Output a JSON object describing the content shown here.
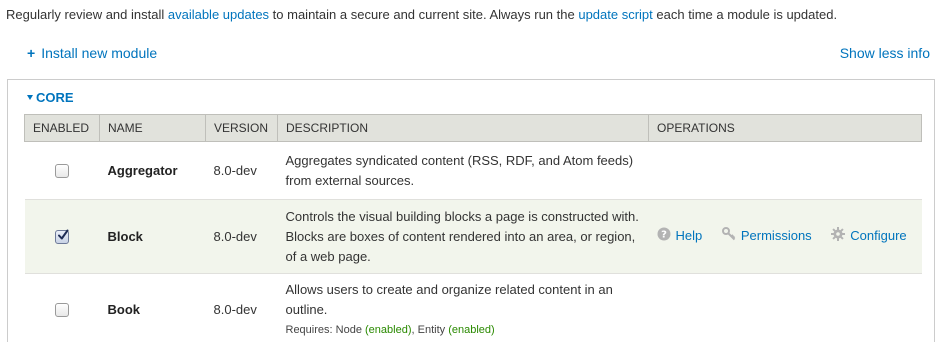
{
  "intro": {
    "text_before": "Regularly review and install ",
    "link_updates": "available updates",
    "text_middle": " to maintain a secure and current site. Always run the ",
    "link_script": "update script",
    "text_after": " each time a module is updated."
  },
  "actions": {
    "install_plus": "+",
    "install_label": "Install new module",
    "show_less": "Show less info"
  },
  "group": {
    "title": "CORE"
  },
  "table": {
    "headers": {
      "enabled": "ENABLED",
      "name": "NAME",
      "version": "VERSION",
      "description": "DESCRIPTION",
      "operations": "OPERATIONS"
    },
    "rows": [
      {
        "enabled": false,
        "name": "Aggregator",
        "version": "8.0-dev",
        "description": "Aggregates syndicated content (RSS, RDF, and Atom feeds) from external sources."
      },
      {
        "enabled": true,
        "name": "Block",
        "version": "8.0-dev",
        "description": "Controls the visual building blocks a page is constructed with. Blocks are boxes of content rendered into an area, or region, of a web page.",
        "operations": {
          "help": "Help",
          "permissions": "Permissions",
          "configure": "Configure"
        }
      },
      {
        "enabled": false,
        "name": "Book",
        "version": "8.0-dev",
        "description": "Allows users to create and organize related content in an outline.",
        "requires": {
          "prefix": "Requires: ",
          "dep1": "Node",
          "dep1_status": "(enabled)",
          "sep": ", ",
          "dep2": "Entity",
          "dep2_status": "(enabled)"
        }
      }
    ]
  },
  "colors": {
    "link": "#0074bd",
    "header_bg": "#e1e2dc",
    "highlight_row": "#f2f5ec",
    "enabled_status": "#2a8a00"
  },
  "icons": {
    "help": "help-question-icon",
    "permissions": "key-icon",
    "configure": "gear-icon",
    "caret": "caret-down-icon",
    "checkbox_checked": "checkmark-icon"
  }
}
